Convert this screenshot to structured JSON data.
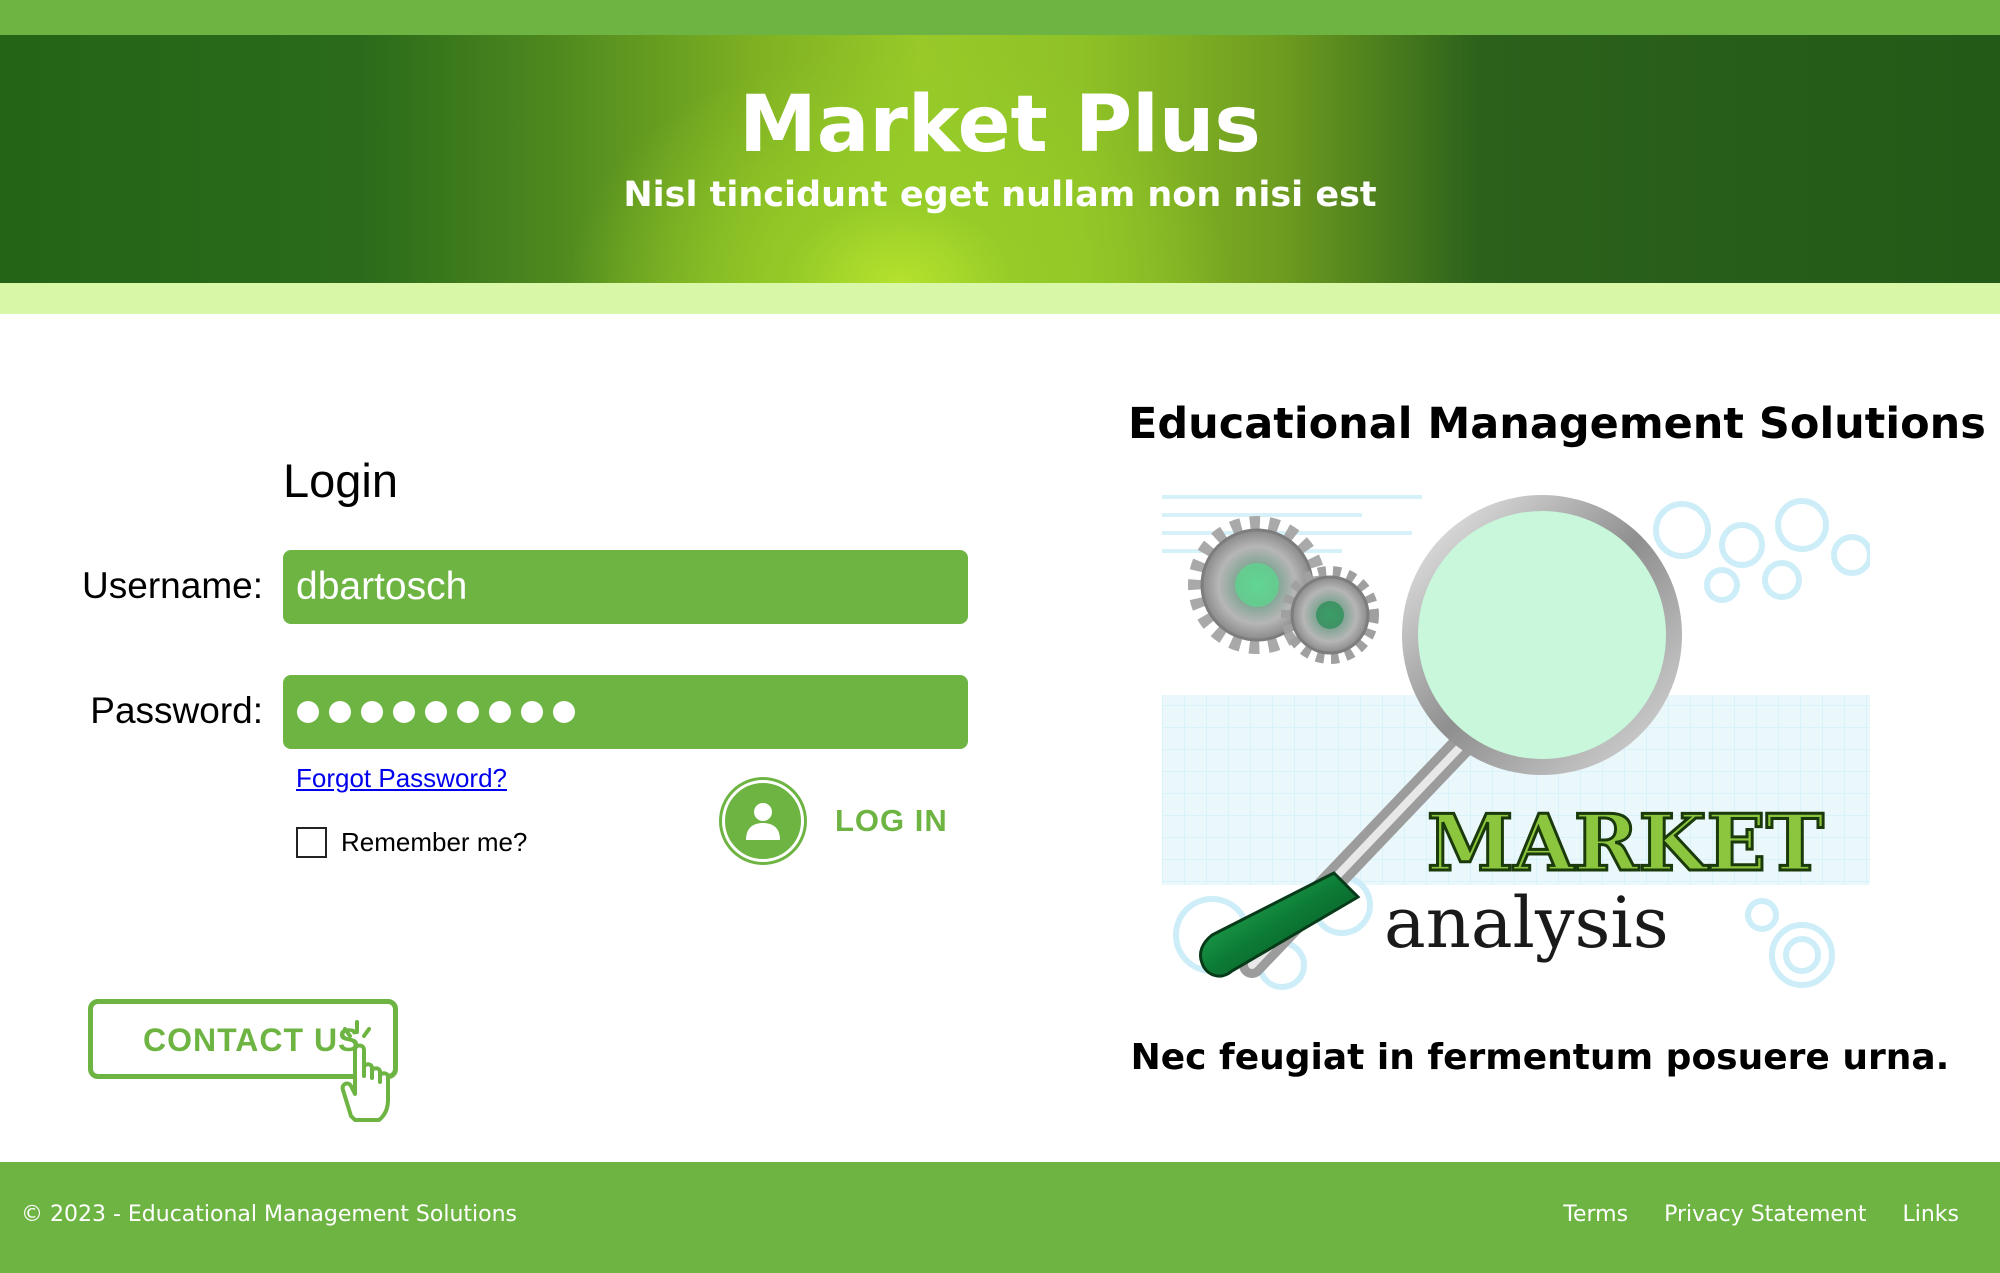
{
  "header": {
    "title": "Market Plus",
    "subtitle": "Nisl tincidunt eget nullam non nisi est"
  },
  "login": {
    "heading": "Login",
    "username_label": "Username:",
    "username_value": "dbartosch",
    "password_label": "Password:",
    "password_mask_count": 9,
    "forgot_link": "Forgot Password?",
    "remember_label": "Remember me?",
    "remember_checked": false,
    "login_button": "LOG IN"
  },
  "contact": {
    "label": "CONTACT US"
  },
  "sidebar": {
    "title": "Educational Management Solutions",
    "image_text_market": "MARKET",
    "image_text_analysis": "analysis",
    "caption": "Nec feugiat in fermentum posuere urna."
  },
  "footer": {
    "copyright": "© 2023 - Educational Management Solutions",
    "links": [
      "Terms",
      "Privacy Statement",
      "Links"
    ]
  },
  "colors": {
    "brand_green": "#6db443",
    "light_green": "#d8f8a8",
    "link_blue": "#0000ee"
  }
}
